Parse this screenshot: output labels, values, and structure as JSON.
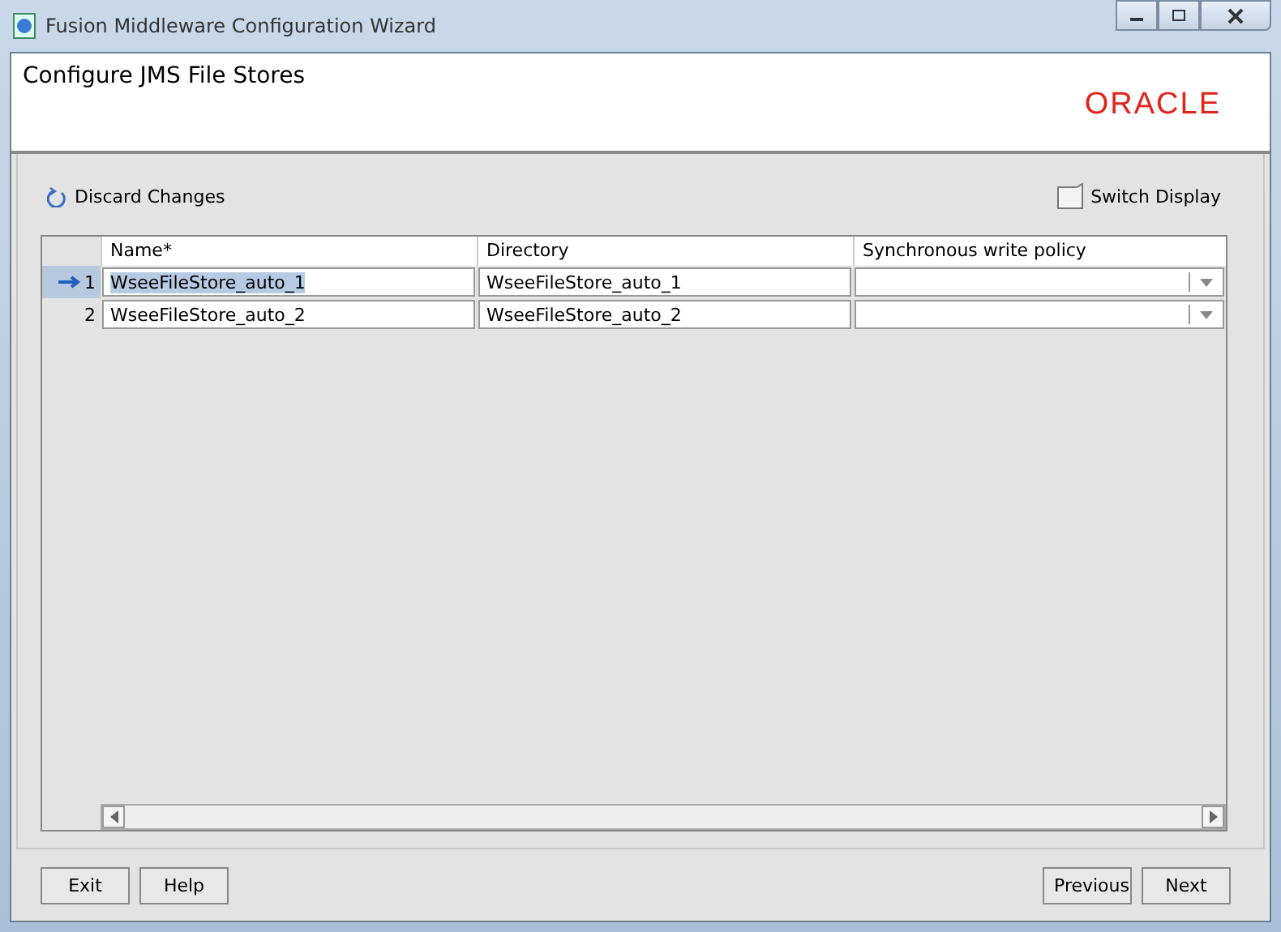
{
  "window": {
    "title": "Fusion Middleware Configuration Wizard"
  },
  "header": {
    "title": "Configure JMS File Stores",
    "logo": "ORACLE"
  },
  "toolbar": {
    "discard": "Discard Changes",
    "switch": "Switch Display"
  },
  "table": {
    "columns": [
      "Name*",
      "Directory",
      "Synchronous write policy"
    ],
    "rows": [
      {
        "number": "1",
        "selected": true,
        "name": "WseeFileStore_auto_1",
        "directory": "WseeFileStore_auto_1"
      },
      {
        "number": "2",
        "selected": false,
        "name": "WseeFileStore_auto_2",
        "directory": "WseeFileStore_auto_2"
      }
    ]
  },
  "buttons": {
    "left": [
      "Exit",
      "Help"
    ],
    "right": [
      "Previous",
      "Next"
    ]
  }
}
